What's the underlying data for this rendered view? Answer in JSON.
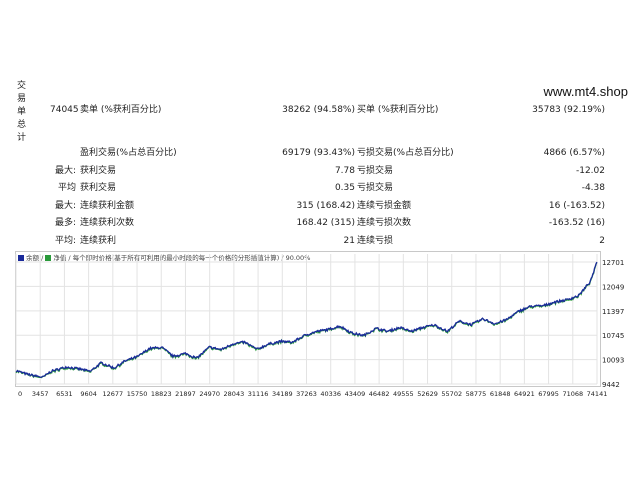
{
  "side_label": [
    "交",
    "易",
    "单",
    "总",
    "计"
  ],
  "brand": "www.mt4.shop",
  "stats": [
    {
      "c1": "74045",
      "c2": "卖单 (%获利百分比)",
      "c3": "38262 (94.58%)",
      "c4": "买单 (%获利百分比)",
      "c5": "35783 (92.19%)"
    },
    {
      "c1": "",
      "c2": "盈利交易(%占总百分比)",
      "c3": "69179 (93.43%)",
      "c4": "亏损交易(%占总百分比)",
      "c5": "4866 (6.57%)"
    },
    {
      "c1": "最大:",
      "c2": "获利交易",
      "c3": "7.78",
      "c4": "亏损交易",
      "c5": "-12.02"
    },
    {
      "c1": "平均",
      "c2": "获利交易",
      "c3": "0.35",
      "c4": "亏损交易",
      "c5": "-4.38"
    },
    {
      "c1": "最大:",
      "c2": "连续获利金额",
      "c3": "315 (168.42)",
      "c4": "连续亏损金额",
      "c5": "16 (-163.52)"
    },
    {
      "c1": "最多:",
      "c2": "连续获利次数",
      "c3": "168.42 (315)",
      "c4": "连续亏损次数",
      "c5": "-163.52 (16)"
    },
    {
      "c1": "平均:",
      "c2": "连续获利",
      "c3": "21",
      "c4": "连续亏损",
      "c5": "2"
    }
  ],
  "legend": {
    "balance_label": "余额",
    "equity_label": "净值",
    "info": "每个即时价格(基于所有可利用的最小时段的每一个价格的分形插值计算) / 90.00%",
    "balance_color": "#1a2a9a",
    "equity_color": "#2a9a3a"
  },
  "chart_data": {
    "type": "line",
    "x_ticks": [
      "0",
      "3457",
      "6531",
      "9604",
      "12677",
      "15750",
      "18823",
      "21897",
      "24970",
      "28043",
      "31116",
      "34189",
      "37263",
      "40336",
      "43409",
      "46482",
      "49555",
      "52629",
      "55702",
      "58775",
      "61848",
      "64921",
      "67995",
      "71068",
      "74141"
    ],
    "y_ticks": [
      "12701",
      "12049",
      "11397",
      "10745",
      "10093",
      "9442"
    ],
    "ylim": [
      9442,
      12701
    ],
    "xlim": [
      0,
      75000
    ],
    "series": [
      {
        "role": "balance",
        "points": [
          [
            0,
            9800
          ],
          [
            1500,
            9700
          ],
          [
            3457,
            9620
          ],
          [
            4500,
            9780
          ],
          [
            6531,
            9900
          ],
          [
            8000,
            9850
          ],
          [
            9604,
            9780
          ],
          [
            11000,
            10010
          ],
          [
            12677,
            9870
          ],
          [
            14000,
            10050
          ],
          [
            15750,
            10180
          ],
          [
            17200,
            10390
          ],
          [
            18823,
            10420
          ],
          [
            20300,
            10180
          ],
          [
            21897,
            10260
          ],
          [
            23300,
            10130
          ],
          [
            24970,
            10430
          ],
          [
            26500,
            10360
          ],
          [
            28043,
            10520
          ],
          [
            29500,
            10560
          ],
          [
            31116,
            10370
          ],
          [
            32600,
            10510
          ],
          [
            34189,
            10580
          ],
          [
            35700,
            10560
          ],
          [
            37263,
            10740
          ],
          [
            38700,
            10840
          ],
          [
            40336,
            10900
          ],
          [
            41800,
            10990
          ],
          [
            43409,
            10800
          ],
          [
            44900,
            10740
          ],
          [
            46482,
            10930
          ],
          [
            48000,
            10850
          ],
          [
            49555,
            10950
          ],
          [
            51000,
            10850
          ],
          [
            52629,
            10960
          ],
          [
            54000,
            11020
          ],
          [
            55702,
            10850
          ],
          [
            57200,
            11120
          ],
          [
            58775,
            11030
          ],
          [
            60300,
            11180
          ],
          [
            61848,
            11050
          ],
          [
            63300,
            11160
          ],
          [
            64921,
            11390
          ],
          [
            66500,
            11520
          ],
          [
            67995,
            11530
          ],
          [
            69500,
            11630
          ],
          [
            71068,
            11690
          ],
          [
            72600,
            11800
          ],
          [
            74141,
            12180
          ],
          [
            75000,
            12700
          ]
        ]
      }
    ]
  }
}
